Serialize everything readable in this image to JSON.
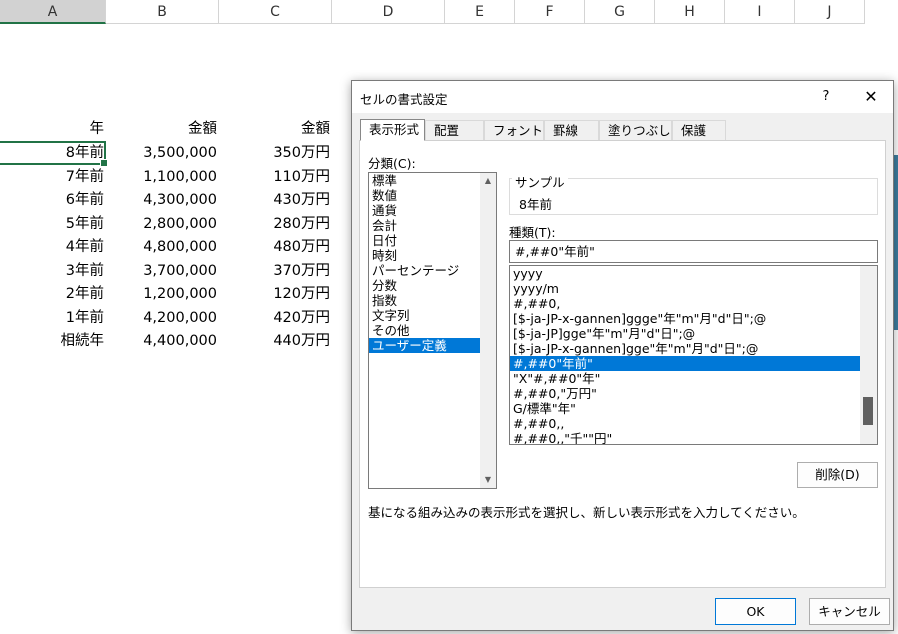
{
  "sheet": {
    "columns": [
      "A",
      "B",
      "C",
      "D",
      "E",
      "F",
      "G",
      "H",
      "I",
      "J"
    ],
    "active_column": "A",
    "headers": {
      "a": "年",
      "b": "金額",
      "c": "金額"
    },
    "rows": [
      {
        "a": "8年前",
        "b": "3,500,000",
        "c": "350万円"
      },
      {
        "a": "7年前",
        "b": "1,100,000",
        "c": "110万円"
      },
      {
        "a": "6年前",
        "b": "4,300,000",
        "c": "430万円"
      },
      {
        "a": "5年前",
        "b": "2,800,000",
        "c": "280万円"
      },
      {
        "a": "4年前",
        "b": "4,800,000",
        "c": "480万円"
      },
      {
        "a": "3年前",
        "b": "3,700,000",
        "c": "370万円"
      },
      {
        "a": "2年前",
        "b": "1,200,000",
        "c": "120万円"
      },
      {
        "a": "1年前",
        "b": "4,200,000",
        "c": "420万円"
      },
      {
        "a": "相続年",
        "b": "4,400,000",
        "c": "440万円"
      }
    ]
  },
  "dialog": {
    "title": "セルの書式設定",
    "help_label": "?",
    "close_label": "✕",
    "tabs": [
      "表示形式",
      "配置",
      "フォント",
      "罫線",
      "塗りつぶし",
      "保護"
    ],
    "active_tab": "表示形式",
    "category_label": "分類(C):",
    "categories": [
      "標準",
      "数値",
      "通貨",
      "会計",
      "日付",
      "時刻",
      "パーセンテージ",
      "分数",
      "指数",
      "文字列",
      "その他",
      "ユーザー定義"
    ],
    "selected_category": "ユーザー定義",
    "sample_label": "サンプル",
    "sample_value": "8年前",
    "type_label": "種類(T):",
    "type_value": "#,##0\"年前\"",
    "formats": [
      "yyyy",
      "yyyy/m",
      "#,##0,",
      "[$-ja-JP-x-gannen]ggge\"年\"m\"月\"d\"日\";@",
      "[$-ja-JP]gge\"年\"m\"月\"d\"日\";@",
      "[$-ja-JP-x-gannen]gge\"年\"m\"月\"d\"日\";@",
      "#,##0\"年前\"",
      "\"X\"#,##0\"年\"",
      "#,##0,\"万円\"",
      "G/標準\"年\"",
      "#,##0,,",
      "#,##0,,\"千\"\"円\""
    ],
    "selected_format_index": 6,
    "delete_label": "削除(D)",
    "description": "基になる組み込みの表示形式を選択し、新しい表示形式を入力してください。",
    "ok_label": "OK",
    "cancel_label": "キャンセル"
  },
  "colors": {
    "accent": "#217346",
    "selection": "#0078d7"
  }
}
